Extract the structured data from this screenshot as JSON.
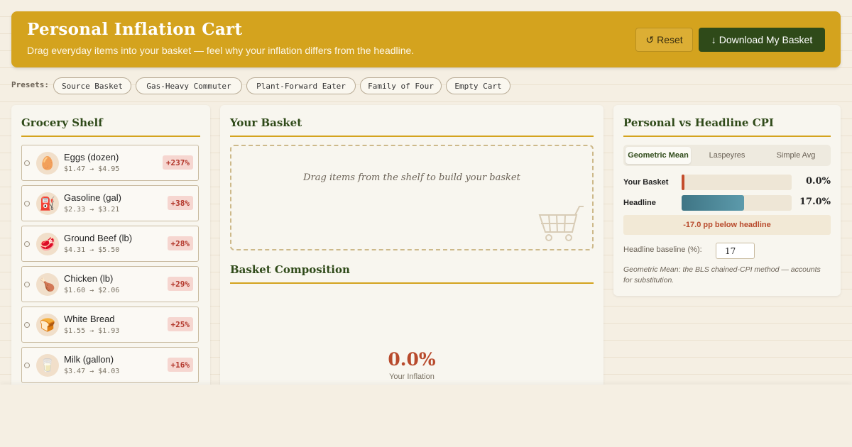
{
  "header": {
    "title": "Personal Inflation Cart",
    "subtitle": "Drag everyday items into your basket — feel why your inflation differs from the headline.",
    "reset_icon": "reset-icon",
    "reset_label": "Reset",
    "download_icon": "download-arrow-icon",
    "download_label": "Download My Basket"
  },
  "presets": {
    "label": "Presets:",
    "items": [
      "Source Basket",
      "Gas-Heavy Commuter",
      "Plant-Forward Eater",
      "Family of Four",
      "Empty Cart"
    ]
  },
  "shelf": {
    "title": "Grocery Shelf",
    "items": [
      {
        "name": "Eggs (dozen)",
        "price": "$1.47 → $4.95",
        "change": "+237%",
        "icon": "egg-icon"
      },
      {
        "name": "Gasoline (gal)",
        "price": "$2.33 → $3.21",
        "change": "+38%",
        "icon": "fuel-pump-icon"
      },
      {
        "name": "Ground Beef (lb)",
        "price": "$4.31 → $5.50",
        "change": "+28%",
        "icon": "meat-icon"
      },
      {
        "name": "Chicken (lb)",
        "price": "$1.60 → $2.06",
        "change": "+29%",
        "icon": "chicken-leg-icon"
      },
      {
        "name": "White Bread",
        "price": "$1.55 → $1.93",
        "change": "+25%",
        "icon": "bread-icon"
      },
      {
        "name": "Milk (gallon)",
        "price": "$3.47 → $4.03",
        "change": "+16%",
        "icon": "milk-icon"
      }
    ]
  },
  "basket": {
    "title": "Your Basket",
    "drop_text": "Drag items from the shelf to build your basket",
    "drop_icon": "cart-icon",
    "composition_title": "Basket Composition",
    "inflation_value": "0.0%",
    "inflation_label": "Your Inflation"
  },
  "compare": {
    "title": "Personal vs Headline CPI",
    "methods": [
      "Geometric Mean",
      "Laspeyres",
      "Simple Avg"
    ],
    "active_method": "Geometric Mean",
    "rows": [
      {
        "label": "Your Basket",
        "value": "0.0%",
        "level": 0.0,
        "color": "#c44d2c"
      },
      {
        "label": "Headline",
        "value": "17.0%",
        "level": 17.0,
        "color": "#4f8d9d"
      }
    ],
    "gap_text": "-17.0 pp below headline",
    "baseline_label": "Headline baseline (%):",
    "baseline_value": "17",
    "method_note": "Geometric Mean: the BLS chained-CPI method — accounts for substitution."
  },
  "colors": {
    "accent": "#d4a31e",
    "primary_dark": "#2f4a19",
    "negative": "#b84a2c",
    "badge_bg": "#f6d6d0"
  }
}
